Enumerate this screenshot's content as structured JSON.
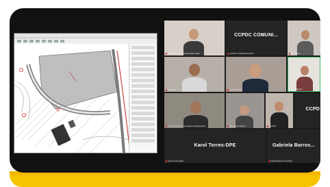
{
  "meeting": {
    "tiles": [
      {
        "id": "t1",
        "name": "CCPDC Trinh Antónia Teofilo Calvo",
        "kind": "video"
      },
      {
        "id": "t2",
        "name": "CCPDC COMUNI...",
        "caption": "CCPDC COMUNICACION",
        "kind": "name"
      },
      {
        "id": "t3",
        "name": "Pía Idrovo",
        "kind": "video"
      },
      {
        "id": "t4",
        "name": "Gerardo",
        "kind": "video"
      },
      {
        "id": "t5",
        "name": "CCPDC Caro",
        "kind": "video"
      },
      {
        "id": "t6",
        "name": "Félix Cabrera",
        "kind": "video"
      },
      {
        "id": "t7",
        "name": "Jaime Carrasco - Fundación El Bienestar",
        "kind": "video"
      },
      {
        "id": "t8",
        "name": "Fernanda Chávez",
        "kind": "video"
      },
      {
        "id": "t9",
        "name": "CCPDC",
        "kind": "video"
      },
      {
        "id": "t10",
        "name": "CCPD",
        "kind": "name"
      },
      {
        "id": "t11",
        "name": "Karol Torres-DPE",
        "caption": "Karol Torres-DPE",
        "kind": "name"
      },
      {
        "id": "t12",
        "name": "Gabriela Barros...",
        "caption": "Gabriela Barros CCPDC",
        "kind": "name"
      }
    ]
  },
  "cad": {
    "window": "CAD drawing viewer",
    "icon": "cad-app-icon"
  },
  "colors": {
    "accent": "#f6c400",
    "card": "#111111",
    "mic_muted": "#d42a2a"
  }
}
